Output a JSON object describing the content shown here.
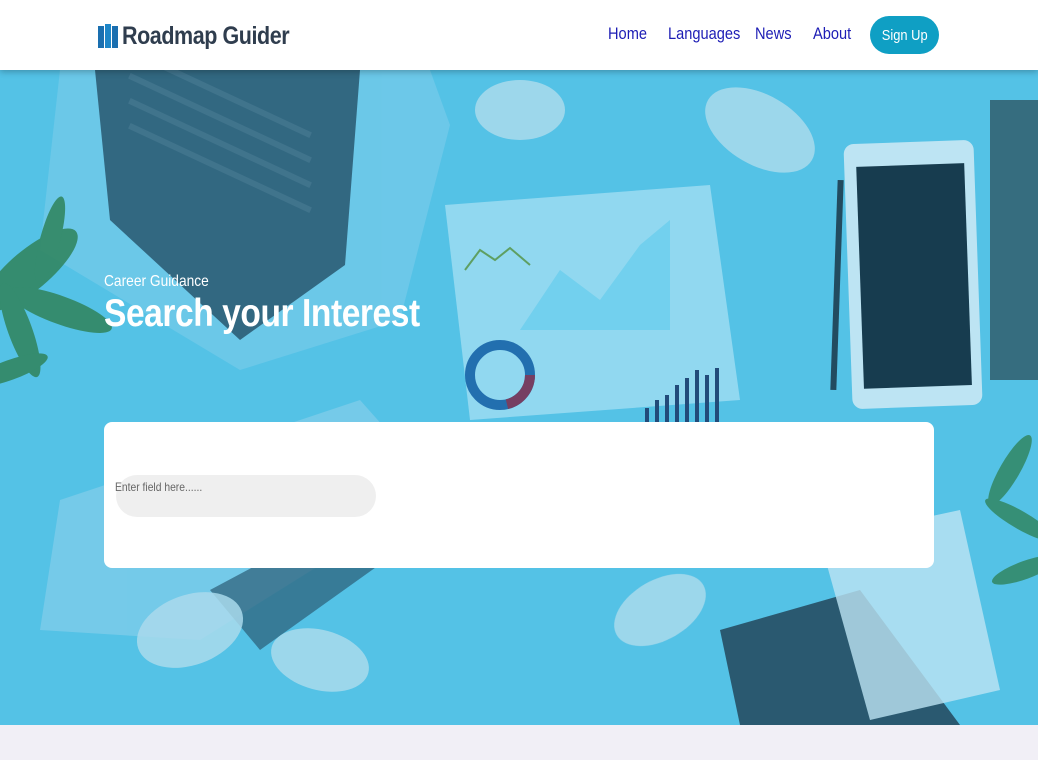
{
  "brand": {
    "name": "Roadmap Guider",
    "icon": "map-icon",
    "color": "#2f3d4e",
    "icon_color": "#1a6fb0"
  },
  "nav": {
    "home": "Home",
    "languages": "Languages",
    "news": "News",
    "about": "About",
    "signup": "Sign Up",
    "link_color": "#1d1db5",
    "signup_color": "#0f9fc4"
  },
  "hero": {
    "eyebrow": "Career Guidance",
    "title": "Search your Interest",
    "overlay_color": "#4fc0e3"
  },
  "search": {
    "placeholder": "Enter field here......",
    "value": ""
  }
}
